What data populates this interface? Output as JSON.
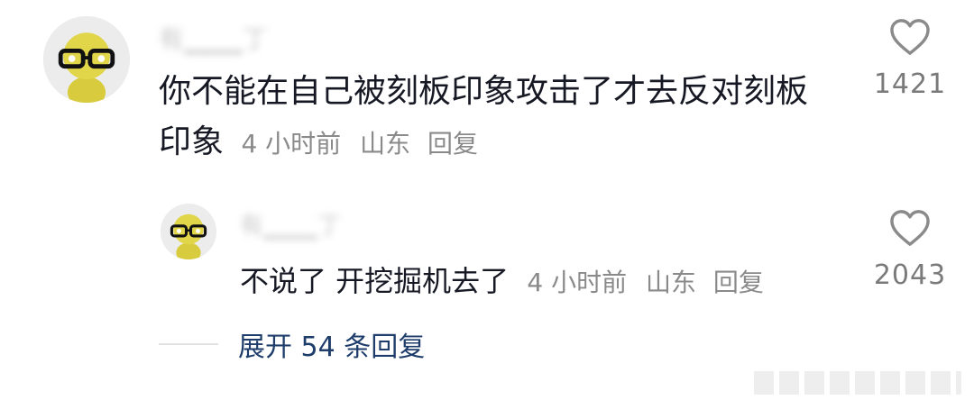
{
  "comment": {
    "username": "有▁▁▁丁",
    "text": "你不能在自己被刻板印象攻击了才去反对刻板印象",
    "time": "4 小时前",
    "location": "山东",
    "reply_label": "回复",
    "likes": "1421"
  },
  "reply": {
    "username": "有▁▁▁丁",
    "text": "不说了 开挖掘机去了",
    "time": "4 小时前",
    "location": "山东",
    "reply_label": "回复",
    "likes": "2043"
  },
  "expand": {
    "label": "展开 54 条回复"
  },
  "icons": {
    "like": "heart-outline-icon",
    "avatar": "yellow-figure-with-glasses-avatar"
  },
  "colors": {
    "text": "#161823",
    "meta": "#8a8a8a",
    "link": "#1e3d6b",
    "heart": "#8a8a8a"
  }
}
